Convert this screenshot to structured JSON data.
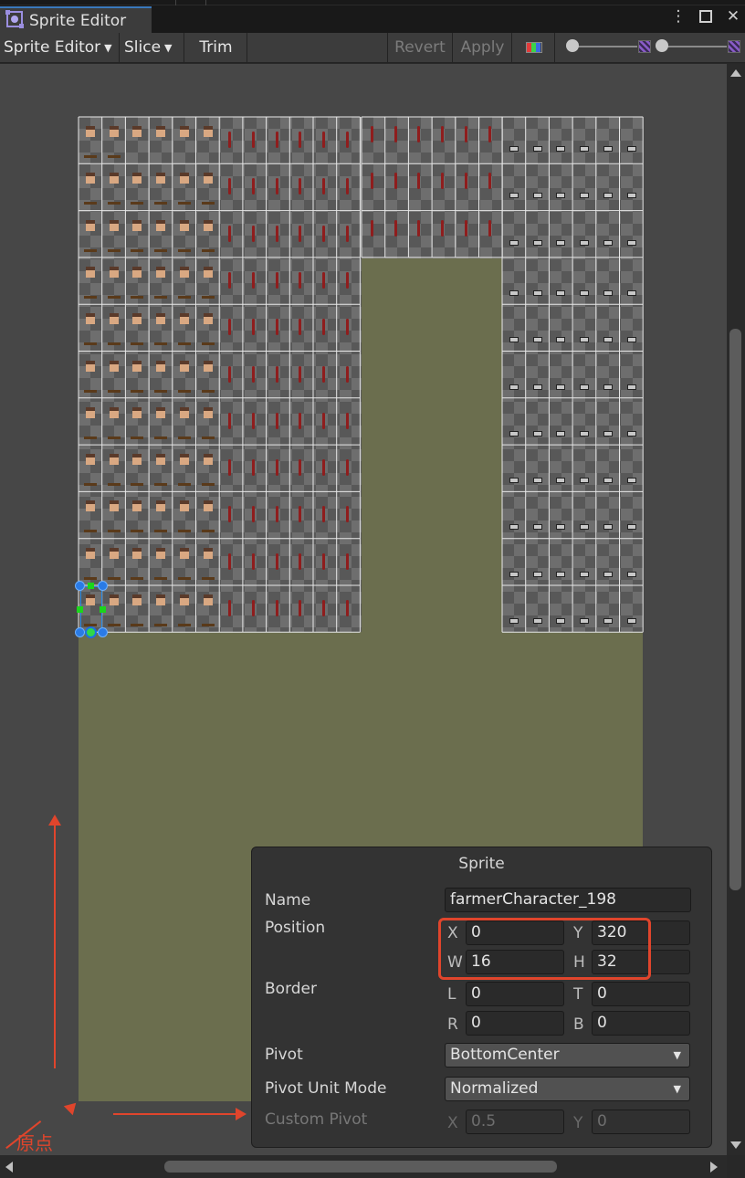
{
  "window": {
    "tab_title": "Sprite Editor",
    "buttons": [
      "more-options",
      "maximize",
      "close"
    ]
  },
  "toolbar": {
    "mode_label": "Sprite Editor",
    "slice_label": "Slice",
    "trim_label": "Trim",
    "revert_label": "Revert",
    "apply_label": "Apply"
  },
  "annotation": {
    "origin_label": "原点"
  },
  "sprite_panel": {
    "title": "Sprite",
    "name_label": "Name",
    "name_value": "farmerCharacter_198",
    "position_label": "Position",
    "x_label": "X",
    "x_value": "0",
    "y_label": "Y",
    "y_value": "320",
    "w_label": "W",
    "w_value": "16",
    "h_label": "H",
    "h_value": "32",
    "border_label": "Border",
    "l_label": "L",
    "l_value": "0",
    "t_label": "T",
    "t_value": "0",
    "r_label": "R",
    "r_value": "0",
    "b_label": "B",
    "b_value": "0",
    "pivot_label": "Pivot",
    "pivot_value": "BottomCenter",
    "pivot_unit_label": "Pivot Unit Mode",
    "pivot_unit_value": "Normalized",
    "custom_pivot_label": "Custom Pivot",
    "custom_x_label": "X",
    "custom_x_value": "0.5",
    "custom_y_label": "Y",
    "custom_y_value": "0"
  }
}
